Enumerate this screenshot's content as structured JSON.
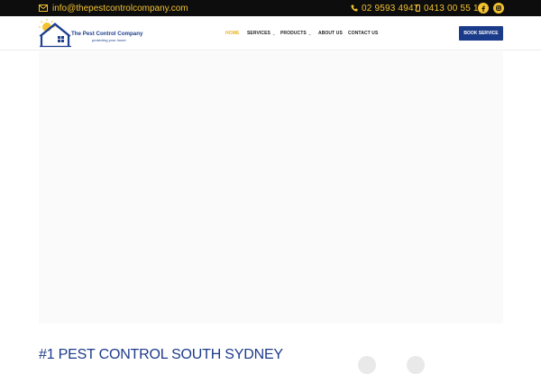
{
  "topbar": {
    "email": "info@thepestcontrolcompany.com",
    "phone_primary": "02 9593 4947",
    "phone_mobile": "0413 00 55 11",
    "social": [
      "facebook-icon",
      "instagram-icon"
    ]
  },
  "header": {
    "logo": {
      "brand": "The Pest Control Company",
      "tagline": "protecting your home"
    },
    "nav": {
      "home": "HOME",
      "services": "SERVICES",
      "products": "PRODUCTS",
      "about": "ABOUT US",
      "contact": "CONTACT US"
    },
    "book_button": "BOOK SERVICE"
  },
  "main": {
    "heading": "#1 PEST CONTROL SOUTH SYDNEY"
  },
  "colors": {
    "topbar_bg": "#0d0d0d",
    "accent_yellow": "#f2c230",
    "brand_blue": "#1a3a8a",
    "active_nav": "#e5b21d"
  }
}
